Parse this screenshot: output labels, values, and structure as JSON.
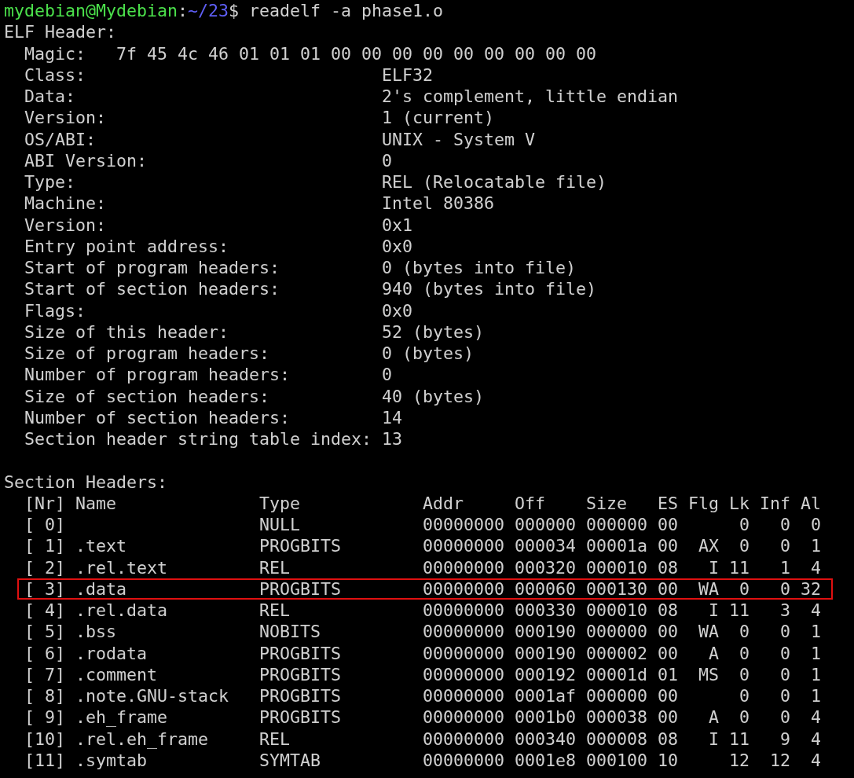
{
  "prompt": {
    "user_host": "mydebian@Mydebian",
    "separator": ":",
    "path": "~/23",
    "symbol": "$",
    "command": "readelf -a phase1.o"
  },
  "elf_header": {
    "title": "ELF Header:",
    "fields": [
      {
        "kind": "magic",
        "label": "Magic:",
        "value": "7f 45 4c 46 01 01 01 00 00 00 00 00 00 00 00 00"
      },
      {
        "kind": "field",
        "label": "Class:",
        "value": "ELF32"
      },
      {
        "kind": "field",
        "label": "Data:",
        "value": "2's complement, little endian"
      },
      {
        "kind": "field",
        "label": "Version:",
        "value": "1 (current)"
      },
      {
        "kind": "field",
        "label": "OS/ABI:",
        "value": "UNIX - System V"
      },
      {
        "kind": "field",
        "label": "ABI Version:",
        "value": "0"
      },
      {
        "kind": "field",
        "label": "Type:",
        "value": "REL (Relocatable file)"
      },
      {
        "kind": "field",
        "label": "Machine:",
        "value": "Intel 80386"
      },
      {
        "kind": "field",
        "label": "Version:",
        "value": "0x1"
      },
      {
        "kind": "field",
        "label": "Entry point address:",
        "value": "0x0"
      },
      {
        "kind": "field",
        "label": "Start of program headers:",
        "value": "0 (bytes into file)"
      },
      {
        "kind": "field",
        "label": "Start of section headers:",
        "value": "940 (bytes into file)"
      },
      {
        "kind": "field",
        "label": "Flags:",
        "value": "0x0"
      },
      {
        "kind": "field",
        "label": "Size of this header:",
        "value": "52 (bytes)"
      },
      {
        "kind": "field",
        "label": "Size of program headers:",
        "value": "0 (bytes)"
      },
      {
        "kind": "field",
        "label": "Number of program headers:",
        "value": "0"
      },
      {
        "kind": "field",
        "label": "Size of section headers:",
        "value": "40 (bytes)"
      },
      {
        "kind": "field",
        "label": "Number of section headers:",
        "value": "14"
      },
      {
        "kind": "field",
        "label": "Section header string table index:",
        "value": "13"
      }
    ]
  },
  "section_headers": {
    "title": "Section Headers:",
    "columns": {
      "nr": "[Nr]",
      "name": "Name",
      "type": "Type",
      "addr": "Addr",
      "off": "Off",
      "size": "Size",
      "es": "ES",
      "flg": "Flg",
      "lk": "Lk",
      "inf": "Inf",
      "al": "Al"
    },
    "rows": [
      {
        "highlighted": false,
        "nr": "[ 0]",
        "type": "NULL",
        "addr": "00000000",
        "off": "000000",
        "size": "000000",
        "es": "00",
        "lk": "0",
        "inf": "0",
        "al": "0"
      },
      {
        "highlighted": false,
        "nr": "[ 1]",
        "name": ".text",
        "type": "PROGBITS",
        "addr": "00000000",
        "off": "000034",
        "size": "00001a",
        "es": "00",
        "flg": "AX",
        "lk": "0",
        "inf": "0",
        "al": "1"
      },
      {
        "highlighted": false,
        "nr": "[ 2]",
        "name": ".rel.text",
        "type": "REL",
        "addr": "00000000",
        "off": "000320",
        "size": "000010",
        "es": "08",
        "flg": "I",
        "lk": "11",
        "inf": "1",
        "al": "4"
      },
      {
        "highlighted": true,
        "nr": "[ 3]",
        "name": ".data",
        "type": "PROGBITS",
        "addr": "00000000",
        "off": "000060",
        "size": "000130",
        "es": "00",
        "flg": "WA",
        "lk": "0",
        "inf": "0",
        "al": "32"
      },
      {
        "highlighted": false,
        "nr": "[ 4]",
        "name": ".rel.data",
        "type": "REL",
        "addr": "00000000",
        "off": "000330",
        "size": "000010",
        "es": "08",
        "flg": "I",
        "lk": "11",
        "inf": "3",
        "al": "4"
      },
      {
        "highlighted": false,
        "nr": "[ 5]",
        "name": ".bss",
        "type": "NOBITS",
        "addr": "00000000",
        "off": "000190",
        "size": "000000",
        "es": "00",
        "flg": "WA",
        "lk": "0",
        "inf": "0",
        "al": "1"
      },
      {
        "highlighted": false,
        "nr": "[ 6]",
        "name": ".rodata",
        "type": "PROGBITS",
        "addr": "00000000",
        "off": "000190",
        "size": "000002",
        "es": "00",
        "flg": "A",
        "lk": "0",
        "inf": "0",
        "al": "1"
      },
      {
        "highlighted": false,
        "nr": "[ 7]",
        "name": ".comment",
        "type": "PROGBITS",
        "addr": "00000000",
        "off": "000192",
        "size": "00001d",
        "es": "01",
        "flg": "MS",
        "lk": "0",
        "inf": "0",
        "al": "1"
      },
      {
        "highlighted": false,
        "nr": "[ 8]",
        "name": ".note.GNU-stack",
        "type": "PROGBITS",
        "addr": "00000000",
        "off": "0001af",
        "size": "000000",
        "es": "00",
        "lk": "0",
        "inf": "0",
        "al": "1"
      },
      {
        "highlighted": false,
        "nr": "[ 9]",
        "name": ".eh_frame",
        "type": "PROGBITS",
        "addr": "00000000",
        "off": "0001b0",
        "size": "000038",
        "es": "00",
        "flg": "A",
        "lk": "0",
        "inf": "0",
        "al": "4"
      },
      {
        "highlighted": false,
        "nr": "[10]",
        "name": ".rel.eh_frame",
        "type": "REL",
        "addr": "00000000",
        "off": "000340",
        "size": "000008",
        "es": "08",
        "flg": "I",
        "lk": "11",
        "inf": "9",
        "al": "4"
      },
      {
        "highlighted": false,
        "nr": "[11]",
        "name": ".symtab",
        "type": "SYMTAB",
        "addr": "00000000",
        "off": "0001e8",
        "size": "000100",
        "es": "10",
        "lk": "12",
        "inf": "12",
        "al": "4"
      }
    ]
  }
}
